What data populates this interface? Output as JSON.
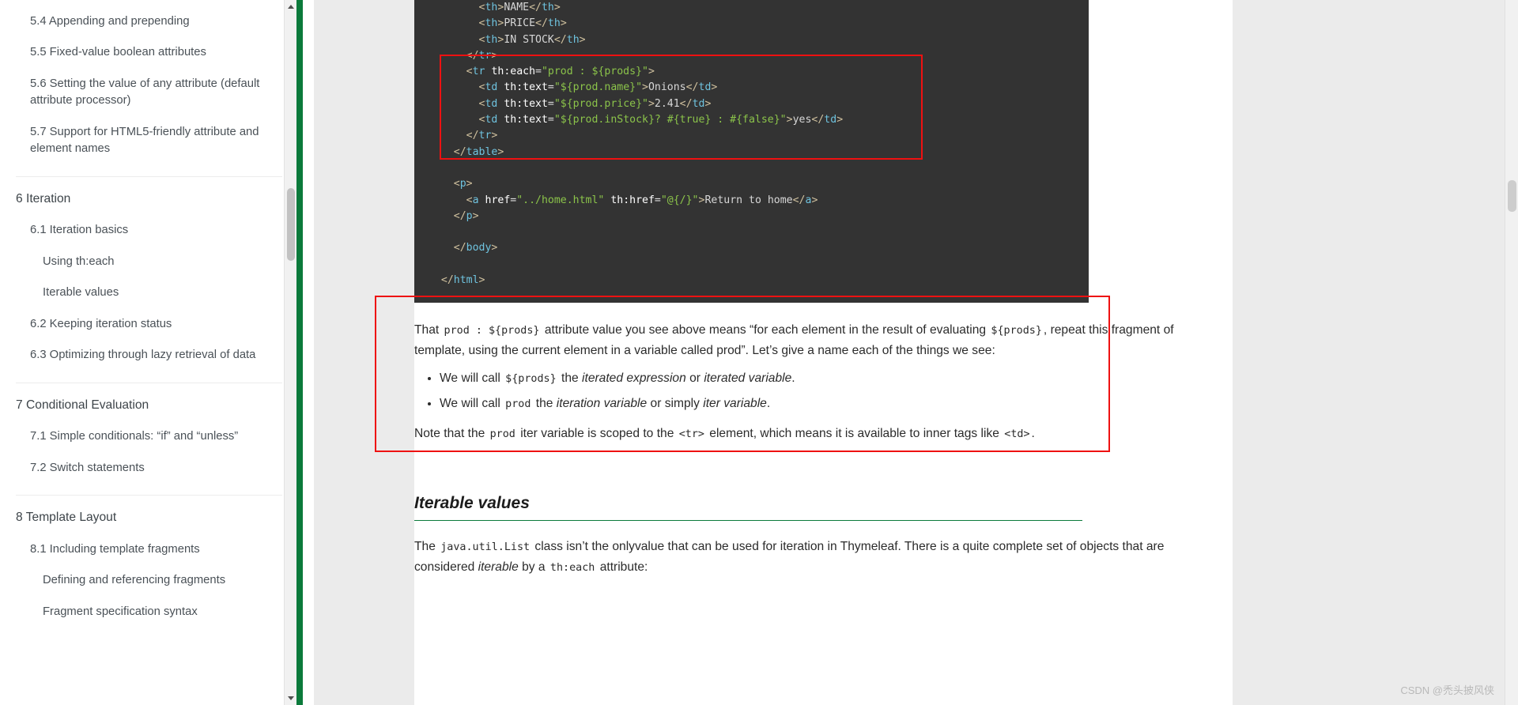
{
  "sidebar": {
    "groups": [
      {
        "items": [
          {
            "label": "5.4 Appending and prepending",
            "level": 2
          },
          {
            "label": "5.5 Fixed-value boolean attributes",
            "level": 2
          },
          {
            "label": "5.6 Setting the value of any attribute (default attribute processor)",
            "level": 2
          },
          {
            "label": "5.7 Support for HTML5-friendly attribute and element names",
            "level": 2
          }
        ]
      },
      {
        "items": [
          {
            "label": "6 Iteration",
            "level": 1
          },
          {
            "label": "6.1 Iteration basics",
            "level": 2
          },
          {
            "label": "Using th:each",
            "level": 3
          },
          {
            "label": "Iterable values",
            "level": 3
          },
          {
            "label": "6.2 Keeping iteration status",
            "level": 2
          },
          {
            "label": "6.3 Optimizing through lazy retrieval of data",
            "level": 2
          }
        ]
      },
      {
        "items": [
          {
            "label": "7 Conditional Evaluation",
            "level": 1
          },
          {
            "label": "7.1 Simple conditionals: “if” and “unless”",
            "level": 2
          },
          {
            "label": "7.2 Switch statements",
            "level": 2
          }
        ]
      },
      {
        "items": [
          {
            "label": "8 Template Layout",
            "level": 1
          },
          {
            "label": "8.1 Including template fragments",
            "level": 2
          },
          {
            "label": "Defining and referencing fragments",
            "level": 3
          },
          {
            "label": "Fragment specification syntax",
            "level": 3
          }
        ]
      }
    ],
    "scroll_up_icon": "triangle-up-icon",
    "scroll_down_icon": "triangle-down-icon"
  },
  "code": {
    "lines": [
      {
        "indent": 4,
        "parts": [
          {
            "t": "<",
            "c": "punct"
          },
          {
            "t": "th",
            "c": "tag"
          },
          {
            "t": ">",
            "c": "punct"
          },
          {
            "t": "NAME",
            "c": "txt"
          },
          {
            "t": "</",
            "c": "punct"
          },
          {
            "t": "th",
            "c": "tag"
          },
          {
            "t": ">",
            "c": "punct"
          }
        ]
      },
      {
        "indent": 4,
        "parts": [
          {
            "t": "<",
            "c": "punct"
          },
          {
            "t": "th",
            "c": "tag"
          },
          {
            "t": ">",
            "c": "punct"
          },
          {
            "t": "PRICE",
            "c": "txt"
          },
          {
            "t": "</",
            "c": "punct"
          },
          {
            "t": "th",
            "c": "tag"
          },
          {
            "t": ">",
            "c": "punct"
          }
        ]
      },
      {
        "indent": 4,
        "parts": [
          {
            "t": "<",
            "c": "punct"
          },
          {
            "t": "th",
            "c": "tag"
          },
          {
            "t": ">",
            "c": "punct"
          },
          {
            "t": "IN STOCK",
            "c": "txt"
          },
          {
            "t": "</",
            "c": "punct"
          },
          {
            "t": "th",
            "c": "tag"
          },
          {
            "t": ">",
            "c": "punct"
          }
        ]
      },
      {
        "indent": 3,
        "parts": [
          {
            "t": "</",
            "c": "punct"
          },
          {
            "t": "tr",
            "c": "tag"
          },
          {
            "t": ">",
            "c": "punct"
          }
        ]
      },
      {
        "indent": 3,
        "parts": [
          {
            "t": "<",
            "c": "punct"
          },
          {
            "t": "tr",
            "c": "tag"
          },
          {
            "t": " ",
            "c": "txt"
          },
          {
            "t": "th:each",
            "c": "attr"
          },
          {
            "t": "=",
            "c": "eq"
          },
          {
            "t": "\"prod : ${prods}\"",
            "c": "str"
          },
          {
            "t": ">",
            "c": "punct"
          }
        ]
      },
      {
        "indent": 4,
        "parts": [
          {
            "t": "<",
            "c": "punct"
          },
          {
            "t": "td",
            "c": "tag"
          },
          {
            "t": " ",
            "c": "txt"
          },
          {
            "t": "th:text",
            "c": "attr"
          },
          {
            "t": "=",
            "c": "eq"
          },
          {
            "t": "\"${prod.name}\"",
            "c": "str"
          },
          {
            "t": ">",
            "c": "punct"
          },
          {
            "t": "Onions",
            "c": "txt"
          },
          {
            "t": "</",
            "c": "punct"
          },
          {
            "t": "td",
            "c": "tag"
          },
          {
            "t": ">",
            "c": "punct"
          }
        ]
      },
      {
        "indent": 4,
        "parts": [
          {
            "t": "<",
            "c": "punct"
          },
          {
            "t": "td",
            "c": "tag"
          },
          {
            "t": " ",
            "c": "txt"
          },
          {
            "t": "th:text",
            "c": "attr"
          },
          {
            "t": "=",
            "c": "eq"
          },
          {
            "t": "\"${prod.price}\"",
            "c": "str"
          },
          {
            "t": ">",
            "c": "punct"
          },
          {
            "t": "2.41",
            "c": "txt"
          },
          {
            "t": "</",
            "c": "punct"
          },
          {
            "t": "td",
            "c": "tag"
          },
          {
            "t": ">",
            "c": "punct"
          }
        ]
      },
      {
        "indent": 4,
        "parts": [
          {
            "t": "<",
            "c": "punct"
          },
          {
            "t": "td",
            "c": "tag"
          },
          {
            "t": " ",
            "c": "txt"
          },
          {
            "t": "th:text",
            "c": "attr"
          },
          {
            "t": "=",
            "c": "eq"
          },
          {
            "t": "\"${prod.inStock}? #{true} : #{false}\"",
            "c": "str"
          },
          {
            "t": ">",
            "c": "punct"
          },
          {
            "t": "yes",
            "c": "txt"
          },
          {
            "t": "</",
            "c": "punct"
          },
          {
            "t": "td",
            "c": "tag"
          },
          {
            "t": ">",
            "c": "punct"
          }
        ]
      },
      {
        "indent": 3,
        "parts": [
          {
            "t": "</",
            "c": "punct"
          },
          {
            "t": "tr",
            "c": "tag"
          },
          {
            "t": ">",
            "c": "punct"
          }
        ]
      },
      {
        "indent": 2,
        "parts": [
          {
            "t": "</",
            "c": "punct"
          },
          {
            "t": "table",
            "c": "tag"
          },
          {
            "t": ">",
            "c": "punct"
          }
        ]
      },
      {
        "indent": 0,
        "parts": []
      },
      {
        "indent": 2,
        "parts": [
          {
            "t": "<",
            "c": "punct"
          },
          {
            "t": "p",
            "c": "tag"
          },
          {
            "t": ">",
            "c": "punct"
          }
        ]
      },
      {
        "indent": 3,
        "parts": [
          {
            "t": "<",
            "c": "punct"
          },
          {
            "t": "a",
            "c": "tag"
          },
          {
            "t": " ",
            "c": "txt"
          },
          {
            "t": "href",
            "c": "attr"
          },
          {
            "t": "=",
            "c": "eq"
          },
          {
            "t": "\"../home.html\"",
            "c": "str"
          },
          {
            "t": " ",
            "c": "txt"
          },
          {
            "t": "th:href",
            "c": "attr"
          },
          {
            "t": "=",
            "c": "eq"
          },
          {
            "t": "\"@{/}\"",
            "c": "str"
          },
          {
            "t": ">",
            "c": "punct"
          },
          {
            "t": "Return to home",
            "c": "txt"
          },
          {
            "t": "</",
            "c": "punct"
          },
          {
            "t": "a",
            "c": "tag"
          },
          {
            "t": ">",
            "c": "punct"
          }
        ]
      },
      {
        "indent": 2,
        "parts": [
          {
            "t": "</",
            "c": "punct"
          },
          {
            "t": "p",
            "c": "tag"
          },
          {
            "t": ">",
            "c": "punct"
          }
        ]
      },
      {
        "indent": 0,
        "parts": []
      },
      {
        "indent": 2,
        "parts": [
          {
            "t": "</",
            "c": "punct"
          },
          {
            "t": "body",
            "c": "tag"
          },
          {
            "t": ">",
            "c": "punct"
          }
        ]
      },
      {
        "indent": 0,
        "parts": []
      },
      {
        "indent": 1,
        "parts": [
          {
            "t": "</",
            "c": "punct"
          },
          {
            "t": "html",
            "c": "tag"
          },
          {
            "t": ">",
            "c": "punct"
          }
        ]
      }
    ]
  },
  "prose": {
    "para1": {
      "seg1": "That ",
      "code1": "prod : ${prods}",
      "seg2": " attribute value you see above means “for each element in the result of evaluating ",
      "code2": "${prods}",
      "seg3": ", repeat this fragment of template, using the current element in a variable called prod”. Let’s give a name each of the things we see:"
    },
    "bullets": [
      {
        "seg1": "We will call ",
        "code": "${prods}",
        "seg2": " the ",
        "em1": "iterated expression",
        "seg3": " or ",
        "em2": "iterated variable",
        "seg4": "."
      },
      {
        "seg1": "We will call ",
        "code": "prod",
        "seg2": " the ",
        "em1": "iteration variable",
        "seg3": " or simply ",
        "em2": "iter variable",
        "seg4": "."
      }
    ],
    "note": {
      "seg1": "Note that the ",
      "code1": "prod",
      "seg2": " iter variable is scoped to the ",
      "code2": "<tr>",
      "seg3": " element, which means it is available to inner tags like ",
      "code3": "<td>",
      "seg4": "."
    },
    "heading": "Iterable values",
    "para2": {
      "seg1": "The ",
      "code1": "java.util.List",
      "seg2": " class isn’t the onlyvalue that can be used for iteration in Thymeleaf. There is a quite complete set of objects that are considered ",
      "em1": "iterable",
      "seg3": " by a ",
      "code2": "th:each",
      "seg4": " attribute:"
    }
  },
  "watermark": {
    "text": "CSDN @禿头披风侠"
  },
  "colors": {
    "accent_green": "#0b7a3b",
    "annotation_red": "#ee1111",
    "code_bg": "#333333",
    "page_bg": "#ffffff",
    "canvas_bg": "#ebebeb"
  }
}
